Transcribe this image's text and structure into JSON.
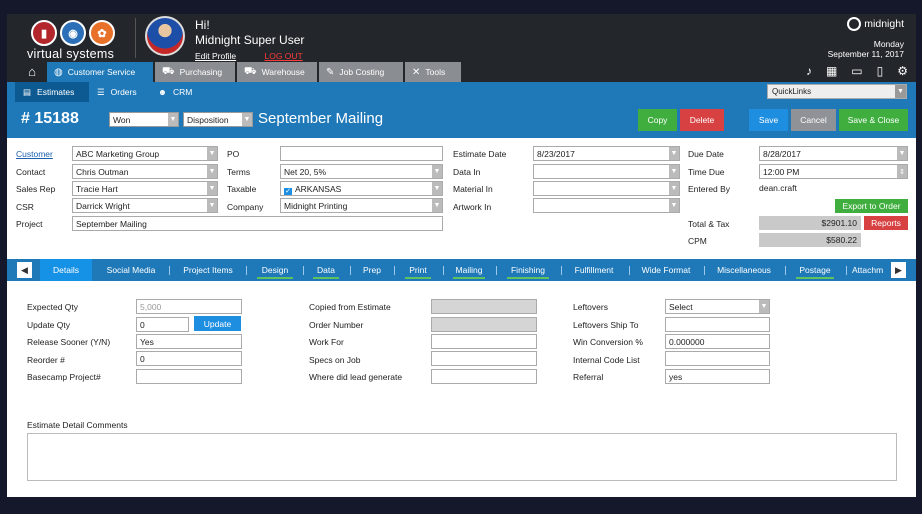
{
  "brand": {
    "logo_text": "virtual systems",
    "app_name": "midnight",
    "day": "Monday",
    "date": "September 11, 2017"
  },
  "user": {
    "greeting": "Hi!",
    "name": "Midnight Super User",
    "edit_profile": "Edit Profile",
    "logout": "LOG OUT"
  },
  "modules": [
    {
      "label": "Customer Service",
      "icon": "headset-icon"
    },
    {
      "label": "Purchasing",
      "icon": "cart-icon"
    },
    {
      "label": "Warehouse",
      "icon": "truck-icon"
    },
    {
      "label": "Job Costing",
      "icon": "wrench-icon"
    },
    {
      "label": "Tools",
      "icon": "tools-icon"
    }
  ],
  "subnav": {
    "estimates": "Estimates",
    "orders": "Orders",
    "crm": "CRM",
    "quicklinks": "QuickLinks"
  },
  "title": {
    "number": "# 15188",
    "status": "Won",
    "disposition": "Disposition",
    "name": "September Mailing"
  },
  "buttons": {
    "copy": "Copy",
    "delete": "Delete",
    "save": "Save",
    "cancel": "Cancel",
    "save_close": "Save & Close",
    "export": "Export to Order",
    "reports": "Reports",
    "update": "Update"
  },
  "form": {
    "customer_label": "Customer",
    "customer": "ABC Marketing Group",
    "contact_label": "Contact",
    "contact": "Chris Outman",
    "salesrep_label": "Sales Rep",
    "salesrep": "Tracie Hart",
    "csr_label": "CSR",
    "csr": "Darrick Wright",
    "project_label": "Project",
    "project": "September Mailing",
    "po_label": "PO",
    "po": "",
    "terms_label": "Terms",
    "terms": "Net 20, 5%",
    "taxable_label": "Taxable",
    "taxable": "ARKANSAS",
    "company_label": "Company",
    "company": "Midnight Printing",
    "estdate_label": "Estimate Date",
    "estdate": "8/23/2017",
    "datain_label": "Data In",
    "datain": "",
    "matin_label": "Material In",
    "matin": "",
    "artin_label": "Artwork In",
    "artin": "",
    "duedate_label": "Due Date",
    "duedate": "8/28/2017",
    "timedue_label": "Time Due",
    "timedue": "12:00 PM",
    "enteredby_label": "Entered By",
    "enteredby": "dean.craft",
    "totaltax_label": "Total & Tax",
    "totaltax": "$2901.10",
    "cpm_label": "CPM",
    "cpm": "$580.22"
  },
  "tabs": [
    "Details",
    "Social Media",
    "Project Items",
    "Design",
    "Data",
    "Prep",
    "Print",
    "Mailing",
    "Finishing",
    "Fulfillment",
    "Wide Format",
    "Miscellaneous",
    "Postage",
    "Attachm"
  ],
  "details": {
    "expqty_label": "Expected Qty",
    "expqty": "5,000",
    "updqty_label": "Update Qty",
    "updqty": "0",
    "release_label": "Release Sooner (Y/N)",
    "release": "Yes",
    "reorder_label": "Reorder #",
    "reorder": "0",
    "basecamp_label": "Basecamp Project#",
    "basecamp": "",
    "copied_label": "Copied from Estimate",
    "copied": "",
    "ordernum_label": "Order Number",
    "ordernum": "",
    "workfor_label": "Work For",
    "workfor": "",
    "specs_label": "Specs on Job",
    "specs": "",
    "leadgen_label": "Where did lead generate",
    "leadgen": "",
    "leftovers_label": "Leftovers",
    "leftovers": "Select",
    "leftship_label": "Leftovers Ship To",
    "leftship": "",
    "winconv_label": "Win Conversion %",
    "winconv": "0.000000",
    "intcode_label": "Internal Code List",
    "intcode": "",
    "referral_label": "Referral",
    "referral": "yes",
    "comments_label": "Estimate Detail Comments",
    "comments": ""
  }
}
